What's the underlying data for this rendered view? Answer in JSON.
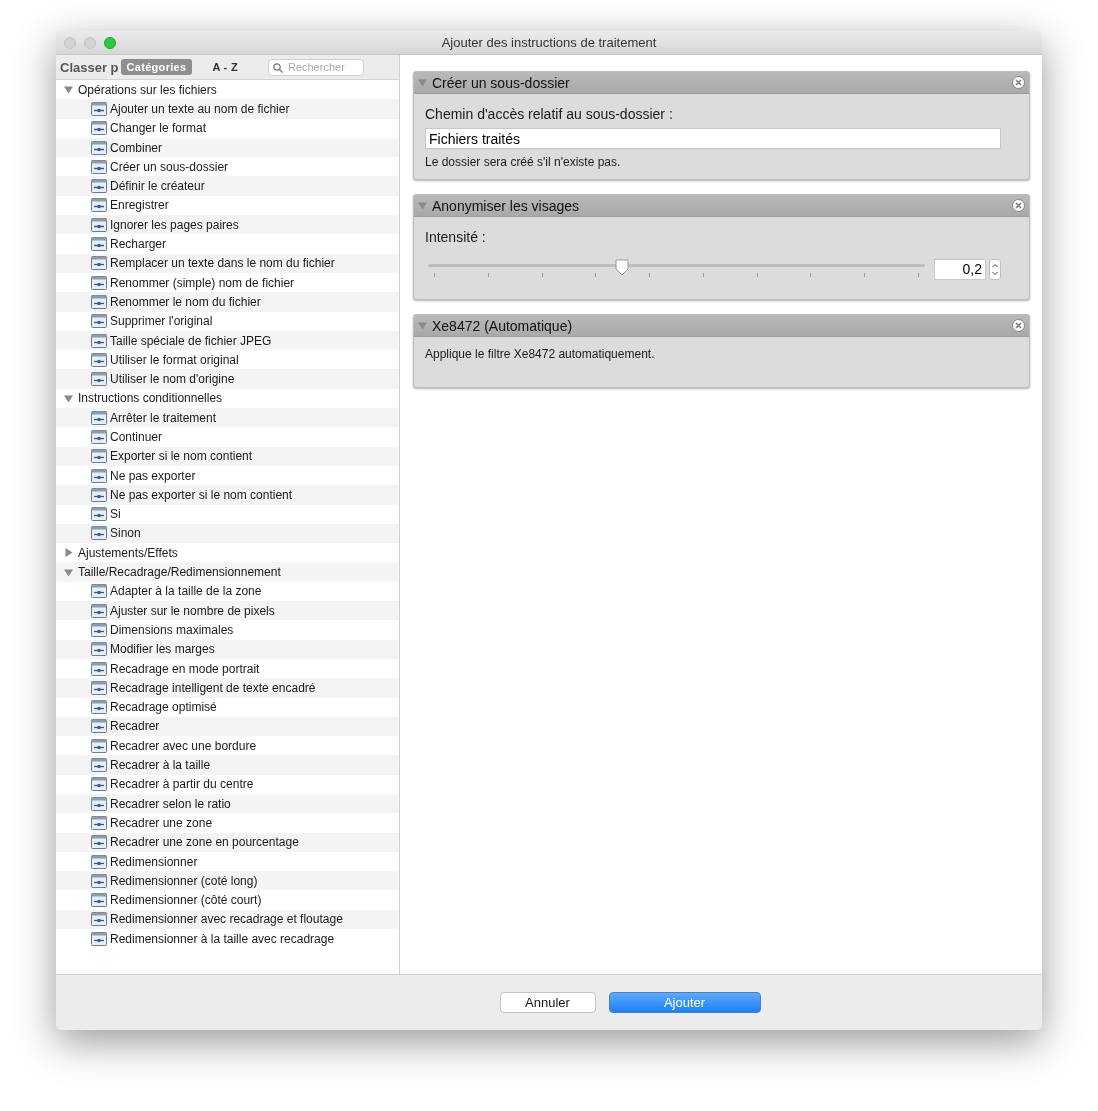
{
  "window": {
    "title": "Ajouter des instructions de traitement"
  },
  "sidebar": {
    "sort_label": "Classer p",
    "tabs": [
      {
        "label": "Catégories",
        "selected": true
      },
      {
        "label": "A - Z",
        "selected": false
      }
    ],
    "search": {
      "placeholder": "Rechercher"
    },
    "groups": [
      {
        "label": "Opérations sur les fichiers",
        "expanded": true,
        "children": [
          "Ajouter un texte au nom de fichier",
          "Changer le format",
          "Combiner",
          "Créer un sous-dossier",
          "Définir le créateur",
          "Enregistrer",
          "Ignorer les pages paires",
          "Recharger",
          "Remplacer un texte dans le nom du fichier",
          "Renommer (simple) nom de fichier",
          "Renommer le nom du fichier",
          "Supprimer l'original",
          "Taille spéciale de fichier JPEG",
          "Utiliser le format original",
          "Utiliser le nom d'origine"
        ]
      },
      {
        "label": "Instructions conditionnelles",
        "expanded": true,
        "children": [
          "Arrêter le traitement",
          "Continuer",
          "Exporter si le nom contient",
          "Ne pas exporter",
          "Ne pas exporter si le nom contient",
          "Si",
          "Sinon"
        ]
      },
      {
        "label": "Ajustements/Effets",
        "expanded": false
      },
      {
        "label": "Taille/Recadrage/Redimensionnement",
        "expanded": true,
        "children": [
          "Adapter à la taille de la zone",
          "Ajuster sur le nombre de pixels",
          "Dimensions maximales",
          "Modifier les marges",
          "Recadrage en mode portrait",
          "Recadrage intelligent de texte encadré",
          "Recadrage optimisé",
          "Recadrer",
          "Recadrer avec une bordure",
          "Recadrer à la taille",
          "Recadrer à partir du centre",
          "Recadrer selon le ratio",
          "Recadrer une zone",
          "Recadrer une zone en pourcentage",
          "Redimensionner",
          "Redimensionner (coté long)",
          "Redimensionner (côté court)",
          "Redimensionner avec recadrage et floutage",
          "Redimensionner à la taille avec recadrage"
        ]
      }
    ]
  },
  "panels": [
    {
      "title": "Créer un sous-dossier",
      "expanded": true,
      "kind": "text-field",
      "label": "Chemin d'accès relatif au sous-dossier :",
      "value": "Fichiers traités",
      "hint": "Le dossier sera créé s'il n'existe pas."
    },
    {
      "title": "Anonymiser les visages",
      "expanded": true,
      "kind": "slider",
      "label": "Intensité :",
      "level": 0.39,
      "reading": "0,2"
    },
    {
      "title": "Xe8472 (Automatique)",
      "expanded": true,
      "kind": "description",
      "text": "Applique le filtre Xe8472 automatiquement."
    }
  ],
  "buttons": [
    {
      "label": "Annuler",
      "kind": "secondary"
    },
    {
      "label": "Ajouter",
      "kind": "primary"
    }
  ]
}
